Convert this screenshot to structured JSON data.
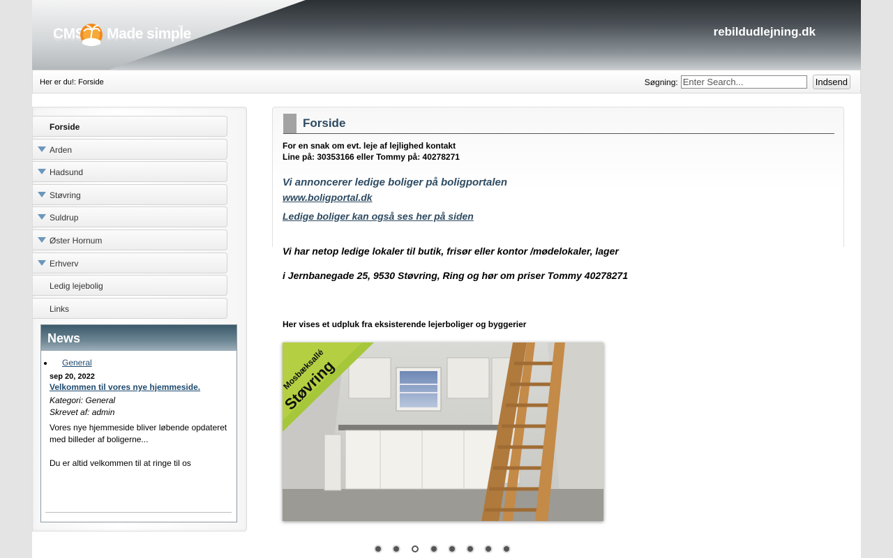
{
  "header": {
    "logo_text_a": "CMS",
    "logo_text_b": "Made simple",
    "logo_tm": "™",
    "site_name": "rebildudlejning.dk"
  },
  "breadcrumb": "Her er du!: Forside",
  "search": {
    "label": "Søgning:",
    "placeholder": "Enter Search...",
    "button": "Indsend"
  },
  "menu": {
    "items": [
      {
        "label": "Forside",
        "current": true,
        "arrow": false
      },
      {
        "label": "Arden",
        "current": false,
        "arrow": true
      },
      {
        "label": "Hadsund",
        "current": false,
        "arrow": true
      },
      {
        "label": "Støvring",
        "current": false,
        "arrow": true
      },
      {
        "label": "Suldrup",
        "current": false,
        "arrow": true
      },
      {
        "label": "Øster Hornum",
        "current": false,
        "arrow": true
      },
      {
        "label": "Erhverv",
        "current": false,
        "arrow": true
      },
      {
        "label": "Ledig lejebolig",
        "current": false,
        "arrow": false
      },
      {
        "label": "Links",
        "current": false,
        "arrow": false
      }
    ]
  },
  "news": {
    "heading": "News",
    "category": "General",
    "date": "sep 20, 2022",
    "title": "Velkommen til vores nye hjemmeside.",
    "category_line": "Kategori: General",
    "author_line": "Skrevet af: admin",
    "text": "Vores nye hjemmeside bliver løbende opdateret med billeder af boligerne...",
    "text2": "Du er altid velkommen til at ringe til os"
  },
  "content": {
    "title": "Forside",
    "contact_line1": "For en snak om evt. leje af lejlighed kontakt",
    "contact_line2": "Line på: 30353166 eller Tommy på: 40278271",
    "announce": "Vi annoncerer ledige boliger på boligportalen",
    "boligportal_link": "www.boligportal.dk",
    "ledige_link": "Ledige boliger kan også ses her på siden",
    "lokaler_line1": "Vi har netop ledige lokaler til butik, frisør eller kontor /mødelokaler, lager",
    "lokaler_line2": "i Jernbanegade 25, 9530 Støvring, Ring og hør om priser Tommy 40278271",
    "gallery_caption": "Her vises et udpluk fra eksisterende lejerboliger og byggerier",
    "slide_badge_line1": "Mosbæksallé",
    "slide_badge_line2": "Støvring"
  },
  "slider": {
    "count": 8,
    "active_index": 2
  }
}
